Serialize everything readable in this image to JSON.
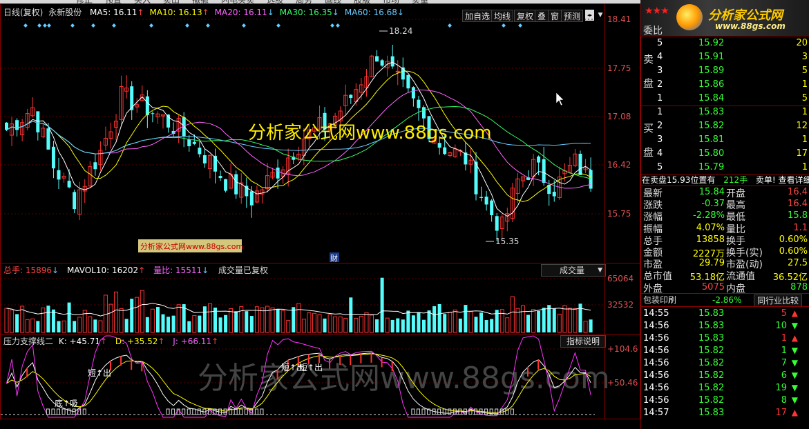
{
  "menu": [
    "修正",
    "预置",
    "买入",
    "卖出",
    "撤撤",
    "闪电买卖",
    "选股",
    "局势",
    "画线",
    "股版",
    "市场",
    "卖量"
  ],
  "main_chart": {
    "period_label": "日线(复权)",
    "stock_name": "永新股份",
    "ma": [
      {
        "label": "MA5: 16.11",
        "arrow": "↑",
        "color": "#ffffff"
      },
      {
        "label": "MA10: 16.13",
        "arrow": "↑",
        "color": "#ffff00"
      },
      {
        "label": "MA20: 16.11",
        "arrow": "↓",
        "color": "#ff66ff"
      },
      {
        "label": "MA30: 16.35",
        "arrow": "↓",
        "color": "#33ff66"
      },
      {
        "label": "MA60: 16.68",
        "arrow": "↓",
        "color": "#66ccff"
      }
    ],
    "buttons": [
      "加自选",
      "均线",
      "复权",
      "叠",
      "窗",
      "预测"
    ],
    "price_ticks": [
      "18.41",
      "17.75",
      "17.08",
      "16.42",
      "15.75"
    ],
    "high_label": "18.24",
    "low_label": "15.35",
    "cai_label": "财",
    "watermark_top": "分析家公式网www.88gs.com",
    "watermark_badge": "分析家公式网www.88gs.com"
  },
  "volume_chart": {
    "total_label": "总手: 15896",
    "total_arrow": "↓",
    "mavol_label": "MAVOL10: 16202",
    "mavol_arrow": "↑",
    "ratio_label": "量比: 15511",
    "ratio_arrow": "↓",
    "note": "成交量已复权",
    "selector": "成交量",
    "ticks": [
      "65064",
      "32532"
    ]
  },
  "indicator_chart": {
    "name": "压力支撑线二",
    "k_label": "K: +45.71",
    "k_arrow": "↑",
    "d_label": "D: +35.52",
    "d_arrow": "↑",
    "j_label": "J: +66.11",
    "j_arrow": "↑",
    "explain_button": "指标说明",
    "ticks": [
      "+104.6",
      "+50.46"
    ],
    "annotations": [
      "短↑出",
      "底↑吸",
      "短↑出",
      "短↑出"
    ],
    "watermark": "分析家公式网www.88gs.com"
  },
  "logo": {
    "site_name": "分析家公式网",
    "url": "www.88gs.com"
  },
  "order_book": {
    "ratio_label": "委比",
    "sell_label_top": "卖",
    "sell_label_bottom": "盘",
    "buy_label_top": "买",
    "buy_label_bottom": "盘",
    "sell": [
      {
        "level": "5",
        "price": "15.92",
        "vol": "20"
      },
      {
        "level": "4",
        "price": "15.91",
        "vol": "3"
      },
      {
        "level": "3",
        "price": "15.89",
        "vol": "5"
      },
      {
        "level": "2",
        "price": "15.86",
        "vol": "1"
      },
      {
        "level": "1",
        "price": "15.84",
        "vol": "5"
      }
    ],
    "buy": [
      {
        "level": "1",
        "price": "15.83",
        "vol": "1"
      },
      {
        "level": "2",
        "price": "15.82",
        "vol": "12"
      },
      {
        "level": "3",
        "price": "15.81",
        "vol": "1"
      },
      {
        "level": "4",
        "price": "15.80",
        "vol": "17"
      },
      {
        "level": "5",
        "price": "15.79",
        "vol": "1"
      }
    ],
    "notice_left": "在卖盘15.93位置有",
    "notice_mid": "212手",
    "notice_right": "卖单! 查看详细"
  },
  "quote": [
    {
      "l1": "最新",
      "v1": "15.84",
      "c1": "#33ff33",
      "l2": "开盘",
      "v2": "16.4",
      "c2": "#ff4444"
    },
    {
      "l1": "涨跌",
      "v1": "-0.37",
      "c1": "#33ff33",
      "l2": "最高",
      "v2": "16.4",
      "c2": "#ff4444"
    },
    {
      "l1": "涨幅",
      "v1": "-2.28%",
      "c1": "#33ff33",
      "l2": "最低",
      "v2": "15.8",
      "c2": "#33ff33"
    },
    {
      "l1": "振幅",
      "v1": "4.07%",
      "c1": "#ffff00",
      "l2": "量比",
      "v2": "1.1",
      "c2": "#ff4444"
    },
    {
      "l1": "总手",
      "v1": "13858",
      "c1": "#ffff00",
      "l2": "换手",
      "v2": "0.60%",
      "c2": "#ffff00"
    },
    {
      "l1": "金额",
      "v1": "2227万",
      "c1": "#ffff00",
      "l2": "换手(实)",
      "v2": "0.60%",
      "c2": "#ffff00"
    },
    {
      "l1": "市盈",
      "v1": "29.79",
      "c1": "#ffff00",
      "l2": "市盈(动)",
      "v2": "27.5",
      "c2": "#ffff00"
    },
    {
      "l1": "总市值",
      "v1": "53.18亿",
      "c1": "#ffff00",
      "l2": "流通值",
      "v2": "36.52亿",
      "c2": "#ffff00"
    },
    {
      "l1": "外盘",
      "v1": "5075",
      "c1": "#ff4444",
      "l2": "内盘",
      "v2": "878",
      "c2": "#33ff33"
    }
  ],
  "print_row": {
    "label": "包装印刷",
    "change": "-2.86%",
    "button": "同行业比较"
  },
  "ticks": [
    {
      "time": "14:55",
      "price": "15.83",
      "vol": "5",
      "dir": "up"
    },
    {
      "time": "14:56",
      "price": "15.83",
      "vol": "10",
      "dir": "down"
    },
    {
      "time": "14:56",
      "price": "15.83",
      "vol": "1",
      "dir": "up"
    },
    {
      "time": "14:56",
      "price": "15.82",
      "vol": "1",
      "dir": "down"
    },
    {
      "time": "14:56",
      "price": "15.82",
      "vol": "7",
      "dir": "down"
    },
    {
      "time": "14:56",
      "price": "15.82",
      "vol": "6",
      "dir": "down"
    },
    {
      "time": "14:56",
      "price": "15.82",
      "vol": "19",
      "dir": "down"
    },
    {
      "time": "14:56",
      "price": "15.82",
      "vol": "8",
      "dir": "down"
    },
    {
      "time": "14:57",
      "price": "15.83",
      "vol": "17",
      "dir": "up"
    }
  ],
  "colors": {
    "up": "#ff3333",
    "down": "#33ff33",
    "cyan": "#54fcfc",
    "border": "#8b0000",
    "yellow": "#ffff00"
  }
}
